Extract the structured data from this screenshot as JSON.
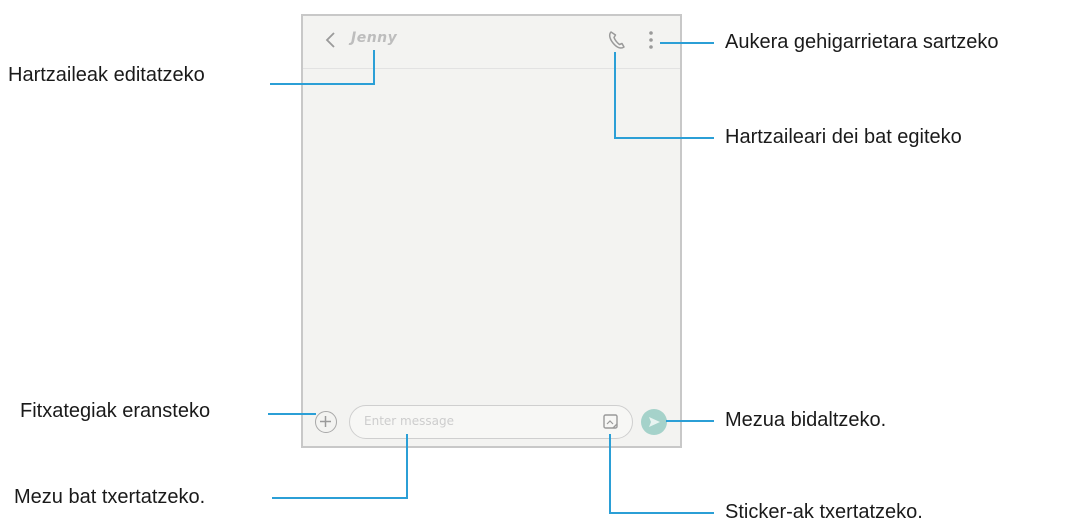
{
  "phone": {
    "contact_name": "Jenny",
    "message_placeholder": "Enter message",
    "icons": {
      "back": "chevron-left-icon",
      "call": "phone-icon",
      "more": "more-vertical-icon",
      "attach": "plus-circle-icon",
      "sticker": "sticker-icon",
      "send": "send-icon"
    }
  },
  "callouts": {
    "edit_recipients": "Hartzaileak editatzeko",
    "more_options": "Aukera gehigarrietara sartzeko",
    "call_recipient": "Hartzaileari dei bat egiteko",
    "attach_files": "Fitxategiak eransteko",
    "send_message": "Mezua bidaltzeko.",
    "enter_message": "Mezu bat txertatzeko.",
    "insert_stickers": "Sticker-ak txertatzeko."
  },
  "colors": {
    "callout_line": "#2b9fd6",
    "send_button": "#a5d2ca"
  }
}
